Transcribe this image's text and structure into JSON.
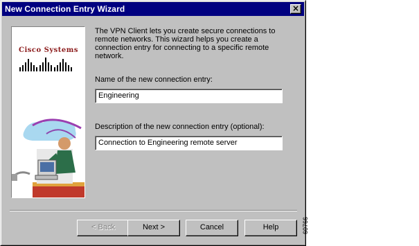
{
  "window": {
    "title": "New Connection Entry Wizard",
    "close_glyph": "×"
  },
  "branding": {
    "logo_text": "Cisco Systems",
    "logo_color": "#8b1a1a"
  },
  "content": {
    "intro_text": "The VPN Client lets you create secure connections to remote networks. This wizard helps you create a connection entry for connecting to a specific remote network.",
    "name_label": "Name of the new connection entry:",
    "name_value": "Engineering",
    "description_label": "Description of the new connection entry (optional):",
    "description_value": "Connection to Engineering remote server"
  },
  "buttons": {
    "back_label": "< Back",
    "next_label": "Next >",
    "cancel_label": "Cancel",
    "help_label": "Help"
  },
  "figure_number": "60766",
  "colors": {
    "titlebar": "#000080",
    "dialog_face": "#c0c0c0"
  }
}
